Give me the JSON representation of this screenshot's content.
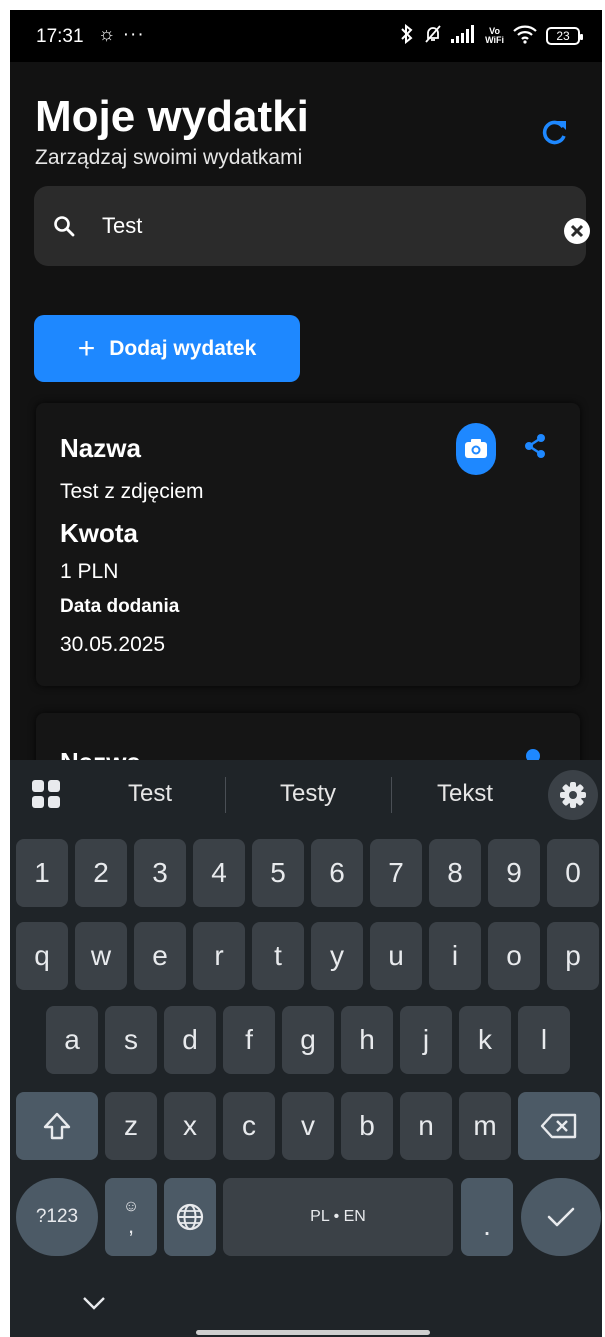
{
  "status_bar": {
    "time": "17:31",
    "extra": "☼ ···",
    "vowifi_top": "Vo",
    "vowifi_bottom": "WiFi",
    "battery": "23",
    "icons": [
      "bluetooth-icon",
      "bell-off-icon",
      "signal-icon",
      "vowifi-icon",
      "wifi-icon",
      "battery-icon"
    ]
  },
  "header": {
    "title": "Moje wydatki",
    "subtitle": "Zarządzaj swoimi wydatkami",
    "refresh_icon": "refresh-icon"
  },
  "search": {
    "value": "Test",
    "icon": "search-icon",
    "clear_icon": "clear-icon"
  },
  "add_button": {
    "icon": "plus",
    "label": "Dodaj wydatek"
  },
  "expenses": [
    {
      "name_label": "Nazwa",
      "name": "Test z zdjęciem",
      "amount_label": "Kwota",
      "amount": "1 PLN",
      "date_label": "Data dodania",
      "date": "30.05.2025",
      "actions": [
        "camera-icon",
        "share-icon"
      ]
    },
    {
      "name_label": "Nazwa"
    }
  ],
  "keyboard": {
    "suggestions": [
      "Test",
      "Testy",
      "Tekst"
    ],
    "number_row": [
      "1",
      "2",
      "3",
      "4",
      "5",
      "6",
      "7",
      "8",
      "9",
      "0"
    ],
    "row1": [
      "q",
      "w",
      "e",
      "r",
      "t",
      "y",
      "u",
      "i",
      "o",
      "p"
    ],
    "row2": [
      "a",
      "s",
      "d",
      "f",
      "g",
      "h",
      "j",
      "k",
      "l"
    ],
    "row3": [
      "z",
      "x",
      "c",
      "v",
      "b",
      "n",
      "m"
    ],
    "symbols_key": "?123",
    "comma_key": ",",
    "space_label": "PL • EN",
    "period_key": ".",
    "colors": {
      "background": "#1f2428",
      "key": "#3b4147",
      "special_key": "#4c5a66"
    }
  },
  "colors": {
    "accent": "#1e88ff",
    "background": "#121212",
    "card": "#151515",
    "search_bg": "#2b2b2b"
  }
}
